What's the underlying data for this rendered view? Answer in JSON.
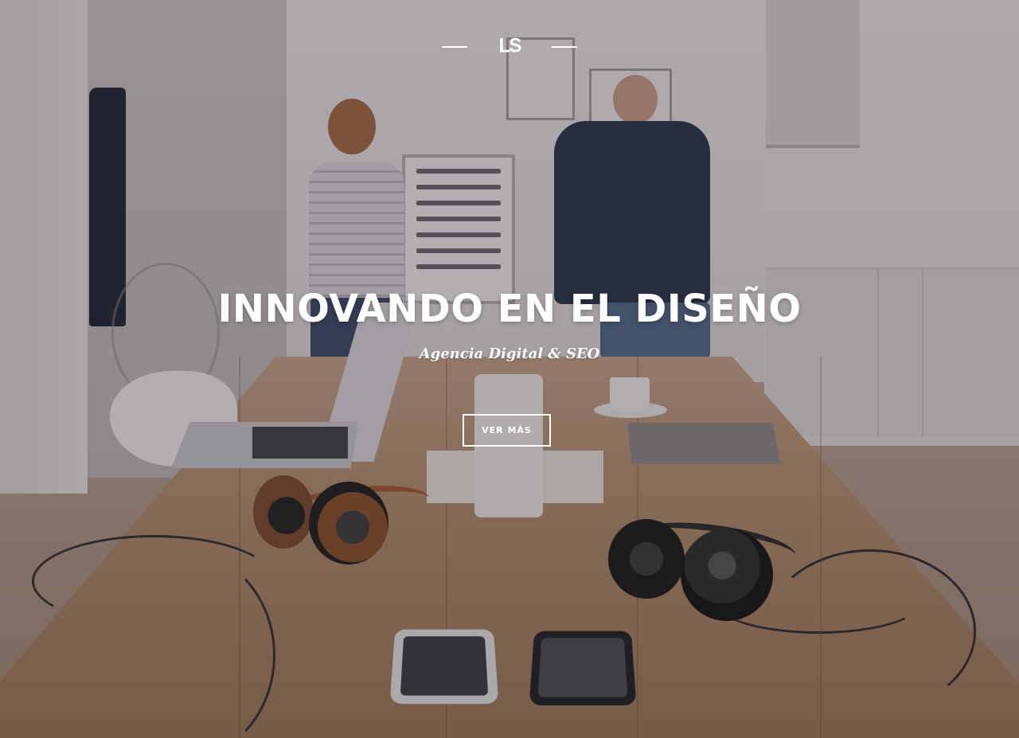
{
  "brand": {
    "logo_text": "LS"
  },
  "hero": {
    "headline": "INNOVANDO EN EL DISEÑO",
    "tagline": "Agencia Digital & SEO",
    "cta_label": "VER MÁS",
    "background_image": "office-table-with-laptops-headphones-and-phones"
  },
  "colors": {
    "text": "#ffffff",
    "overlay": "#241e28"
  }
}
